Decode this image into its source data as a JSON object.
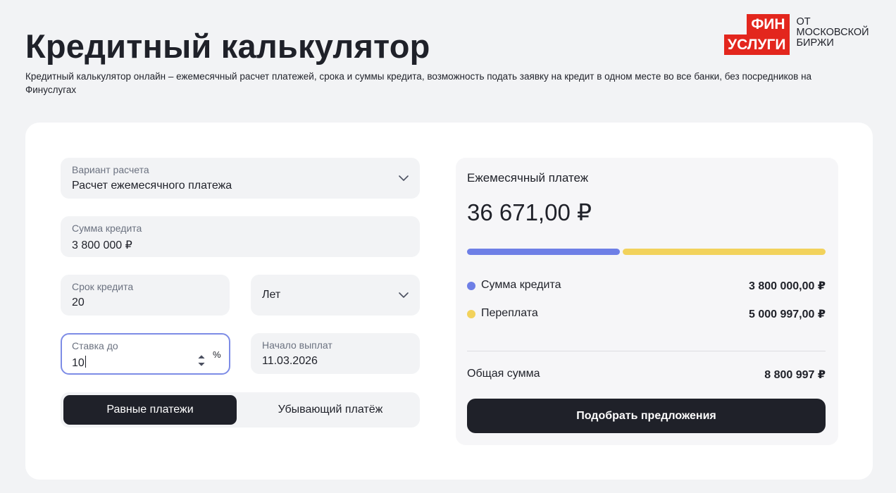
{
  "header": {
    "title": "Кредитный калькулятор",
    "subtitle": "Кредитный калькулятор онлайн – ежемесячный расчет платежей, срока и суммы кредита, возможность подать заявку на кредит в одном месте во все банки, без посредников на Финуслугах"
  },
  "logo": {
    "line1": "ФИН",
    "line2": "УСЛУГИ",
    "caption1": "от",
    "caption2": "Московской",
    "caption3": "биржи"
  },
  "form": {
    "variant": {
      "label": "Вариант расчета",
      "value": "Расчет ежемесячного платежа"
    },
    "sum": {
      "label": "Сумма кредита",
      "value": "3 800 000 ₽"
    },
    "term": {
      "label": "Срок кредита",
      "value": "20"
    },
    "term_unit": {
      "value": "Лет"
    },
    "rate": {
      "label": "Ставка до",
      "value": "10",
      "suffix": "%"
    },
    "start": {
      "label": "Начало выплат",
      "value": "11.03.2026"
    },
    "payment_type": {
      "active": "Равные платежи",
      "inactive": "Убывающий платёж"
    }
  },
  "result": {
    "title": "Ежемесячный платеж",
    "amount": "36 671,00 ₽",
    "credit_share": 0.43,
    "credit_label": "Сумма кредита",
    "credit_value": "3 800 000,00 ₽",
    "overpay_label": "Переплата",
    "overpay_value": "5 000 997,00 ₽",
    "total_label": "Общая сумма",
    "total_value": "8 800 997 ₽",
    "button": "Подобрать предложения"
  },
  "colors": {
    "credit": "#6e7fe6",
    "overpay": "#f2d25c",
    "logo_red": "#e3261d",
    "dark": "#1f2129"
  },
  "icons": {
    "variant_dropdown": "chevron-down-icon",
    "unit_dropdown": "chevron-down-icon",
    "rate_spinner": "spinner-icon"
  }
}
